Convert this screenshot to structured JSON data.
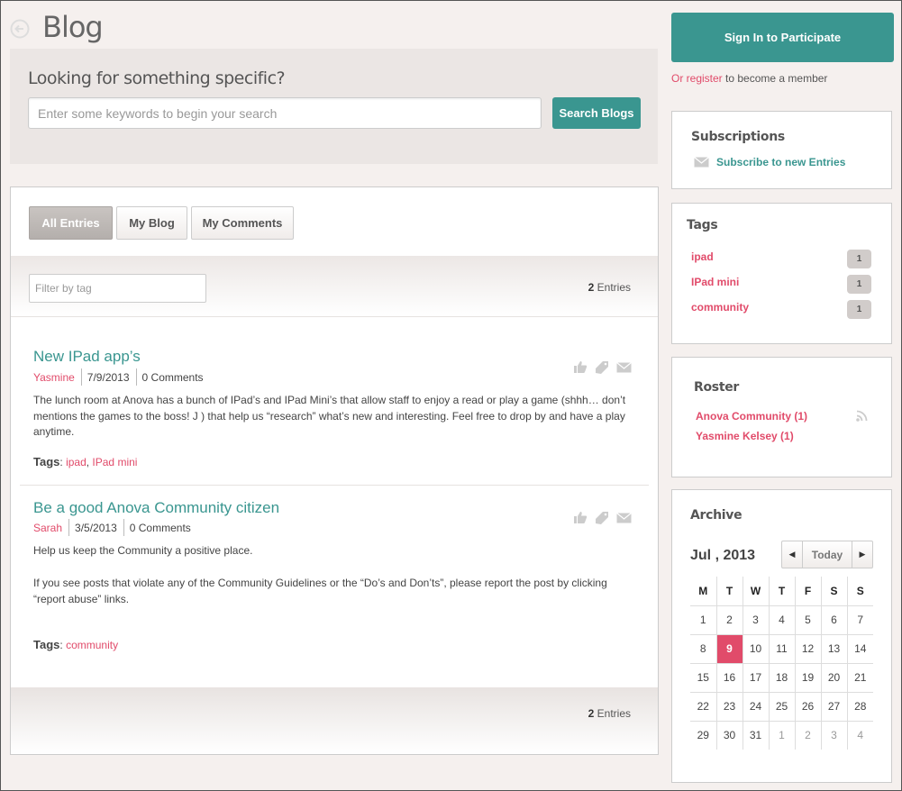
{
  "header": {
    "title": "Blog"
  },
  "search": {
    "heading": "Looking for something specific?",
    "placeholder": "Enter some keywords to begin your search",
    "button_label": "Search Blogs"
  },
  "tabs": [
    {
      "label": "All Entries",
      "active": true
    },
    {
      "label": "My Blog",
      "active": false
    },
    {
      "label": "My Comments",
      "active": false
    }
  ],
  "filter": {
    "placeholder": "Filter by tag"
  },
  "entry_count": {
    "number": "2",
    "label": "Entries"
  },
  "entries": [
    {
      "title": "New IPad app’s",
      "author": "Yasmine",
      "date": "7/9/2013",
      "comments": "0 Comments",
      "body": "The lunch room at Anova has a bunch of IPad’s and IPad Mini’s that allow staff to enjoy a read or play a game (shhh… don’t mentions the games to the boss! J ) that help us “research” what’s new and interesting. Feel free to drop by and have a play anytime.",
      "tags_label": "Tags",
      "tags": [
        "ipad",
        "IPad mini"
      ]
    },
    {
      "title": "Be a good Anova Community citizen",
      "author": "Sarah",
      "date": "3/5/2013",
      "comments": "0 Comments",
      "body": "Help us keep the Community a positive place.",
      "body2": "If you see posts that violate any of the Community Guidelines or the “Do’s and Don’ts”, please report the post by clicking “report abuse” links.",
      "tags_label": "Tags",
      "tags": [
        "community"
      ]
    }
  ],
  "sidebar": {
    "signin_label": "Sign In to Participate",
    "register_link": "Or register",
    "register_rest": " to become a member",
    "subscriptions": {
      "title": "Subscriptions",
      "link": "Subscribe to new Entries"
    },
    "tags": {
      "title": "Tags",
      "items": [
        {
          "name": "ipad",
          "count": "1"
        },
        {
          "name": "IPad mini",
          "count": "1"
        },
        {
          "name": "community",
          "count": "1"
        }
      ]
    },
    "roster": {
      "title": "Roster",
      "items": [
        "Anova Community (1)",
        "Yasmine Kelsey (1)"
      ]
    },
    "archive": {
      "title": "Archive",
      "month": "Jul , 2013",
      "today_label": "Today",
      "weekdays": [
        "M",
        "T",
        "W",
        "T",
        "F",
        "S",
        "S"
      ],
      "weeks": [
        [
          "1",
          "2",
          "3",
          "4",
          "5",
          "6",
          "7"
        ],
        [
          "8",
          "9",
          "10",
          "11",
          "12",
          "13",
          "14"
        ],
        [
          "15",
          "16",
          "17",
          "18",
          "19",
          "20",
          "21"
        ],
        [
          "22",
          "23",
          "24",
          "25",
          "26",
          "27",
          "28"
        ],
        [
          "29",
          "30",
          "31",
          "1",
          "2",
          "3",
          "4"
        ]
      ],
      "selected_day": "9"
    }
  },
  "colors": {
    "accent": "#3a9690",
    "link": "#e14b6a",
    "background": "#f5f0ee"
  },
  "icons": [
    "back-arrow-icon",
    "thumbs-up-icon",
    "tag-icon",
    "envelope-icon",
    "rss-icon",
    "chevron-left-icon",
    "chevron-right-icon"
  ]
}
